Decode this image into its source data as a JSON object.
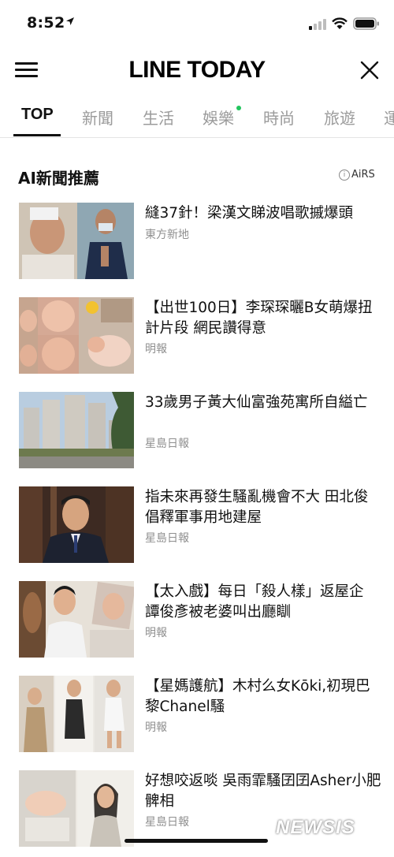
{
  "status_bar": {
    "time": "8:52"
  },
  "header": {
    "logo": "LINE TODAY"
  },
  "tabs": [
    {
      "label": "TOP"
    },
    {
      "label": "新聞"
    },
    {
      "label": "生活"
    },
    {
      "label": "娛樂"
    },
    {
      "label": "時尚"
    },
    {
      "label": "旅遊"
    },
    {
      "label": "運"
    }
  ],
  "section": {
    "title": "AI新聞推薦",
    "badge": "AiRS",
    "badge_icon": "info-icon"
  },
  "articles": [
    {
      "headline": "縫37針！梁漢文睇波唱歌摵爆頭",
      "source": "東方新地"
    },
    {
      "headline": "【出世100日】李琛琛曬B女萌爆扭計片段 網民讚得意",
      "source": "明報"
    },
    {
      "headline": "33歲男子黃大仙富強苑寓所自縊亡",
      "source": "星島日報"
    },
    {
      "headline": "指未來再發生騷亂機會不大 田北俊倡釋軍事用地建屋",
      "source": "星島日報"
    },
    {
      "headline": "【太入戲】每日「殺人樣」返屋企 譚俊彥被老婆叫出廳瞓",
      "source": "明報"
    },
    {
      "headline": "【星媽護航】木村么女Kōki,初現巴黎Chanel騷",
      "source": "明報"
    },
    {
      "headline": "好想咬返啖 吳雨霏騷囝囝Asher小肥髀相",
      "source": "星島日報"
    }
  ],
  "watermark": "NEWSIS",
  "colors": {
    "tab_dot": "#22c55e",
    "active_tab": "#111111",
    "inactive_tab": "#9b9b9b"
  }
}
